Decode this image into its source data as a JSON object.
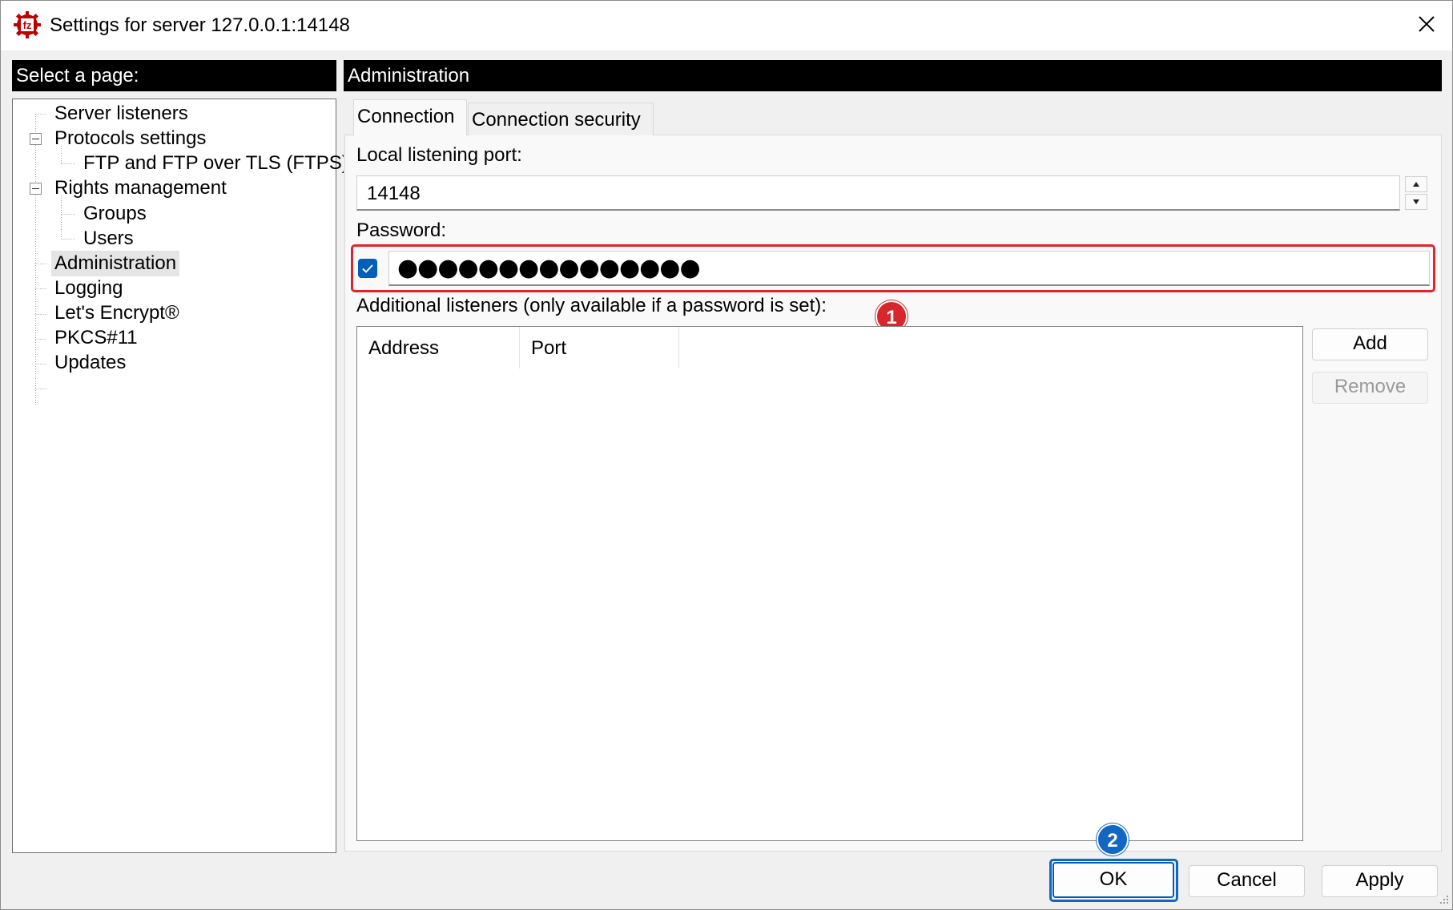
{
  "window": {
    "title": "Settings for server 127.0.0.1:14148"
  },
  "left_panel": {
    "header": "Select a page:",
    "tree": [
      {
        "label": "Server listeners"
      },
      {
        "label": "Protocols settings",
        "expanded": true
      },
      {
        "label": "FTP and FTP over TLS (FTPS)"
      },
      {
        "label": "Rights management",
        "expanded": true
      },
      {
        "label": "Groups"
      },
      {
        "label": "Users"
      },
      {
        "label": "Administration",
        "selected": true
      },
      {
        "label": "Logging"
      },
      {
        "label": "Let's Encrypt®"
      },
      {
        "label": "PKCS#11"
      },
      {
        "label": "Updates"
      }
    ]
  },
  "right_panel": {
    "header": "Administration",
    "tabs": [
      {
        "label": "Connection",
        "active": true
      },
      {
        "label": "Connection security"
      }
    ],
    "port_label": "Local listening port:",
    "port_value": "14148",
    "password_label": "Password:",
    "password_enabled": true,
    "password_value": "●●●●●●●●●●●●●●●",
    "listeners_label": "Additional listeners (only available if a password is set):",
    "columns": [
      "Address",
      "Port"
    ],
    "add_label": "Add",
    "remove_label": "Remove"
  },
  "footer": {
    "ok_label": "OK",
    "cancel_label": "Cancel",
    "apply_label": "Apply"
  },
  "annotations": [
    {
      "number": "1",
      "color": "#d8262d"
    },
    {
      "number": "2",
      "color": "#1266c4"
    }
  ],
  "colors": {
    "accent": "#005fb8",
    "highlight_red": "#e0242e",
    "highlight_blue": "#1266c4"
  },
  "icons": {
    "app": "filezilla-server-icon",
    "close": "close-icon",
    "checkbox": "checkmark-icon",
    "spin_up": "arrow-up-icon",
    "spin_down": "arrow-down-icon",
    "tree_expand": "minus-box-icon",
    "resize": "resize-grip-icon"
  }
}
